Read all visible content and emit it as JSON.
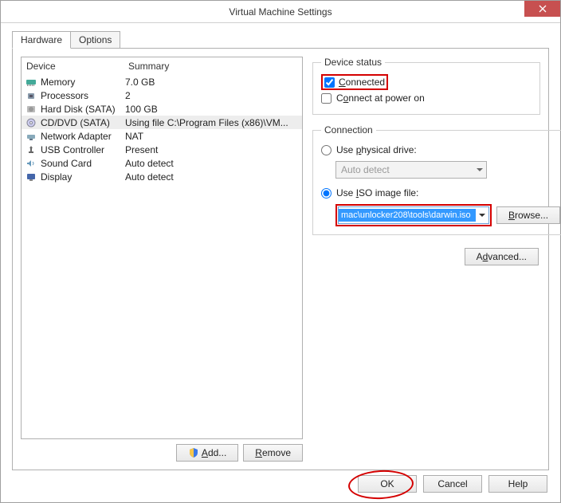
{
  "window": {
    "title": "Virtual Machine Settings"
  },
  "tabs": {
    "hardware": "Hardware",
    "options": "Options"
  },
  "deviceList": {
    "headers": {
      "device": "Device",
      "summary": "Summary"
    },
    "rows": [
      {
        "name": "Memory",
        "summary": "7.0 GB",
        "icon": "memory"
      },
      {
        "name": "Processors",
        "summary": "2",
        "icon": "cpu"
      },
      {
        "name": "Hard Disk (SATA)",
        "summary": "100 GB",
        "icon": "hdd"
      },
      {
        "name": "CD/DVD (SATA)",
        "summary": "Using file C:\\Program Files (x86)\\VM...",
        "icon": "cd",
        "selected": true
      },
      {
        "name": "Network Adapter",
        "summary": "NAT",
        "icon": "net"
      },
      {
        "name": "USB Controller",
        "summary": "Present",
        "icon": "usb"
      },
      {
        "name": "Sound Card",
        "summary": "Auto detect",
        "icon": "sound"
      },
      {
        "name": "Display",
        "summary": "Auto detect",
        "icon": "display"
      }
    ],
    "addBtn": "Add...",
    "removeBtn": "Remove"
  },
  "deviceStatus": {
    "legend": "Device status",
    "connected": "Connected",
    "connectAtPowerOn": "Connect at power on"
  },
  "connection": {
    "legend": "Connection",
    "usePhysical": "Use physical drive:",
    "physicalValue": "Auto detect",
    "useIso": "Use ISO image file:",
    "isoPath": "mac\\unlocker208\\tools\\darwin.iso",
    "browse": "Browse..."
  },
  "advanced": "Advanced...",
  "buttons": {
    "ok": "OK",
    "cancel": "Cancel",
    "help": "Help"
  }
}
